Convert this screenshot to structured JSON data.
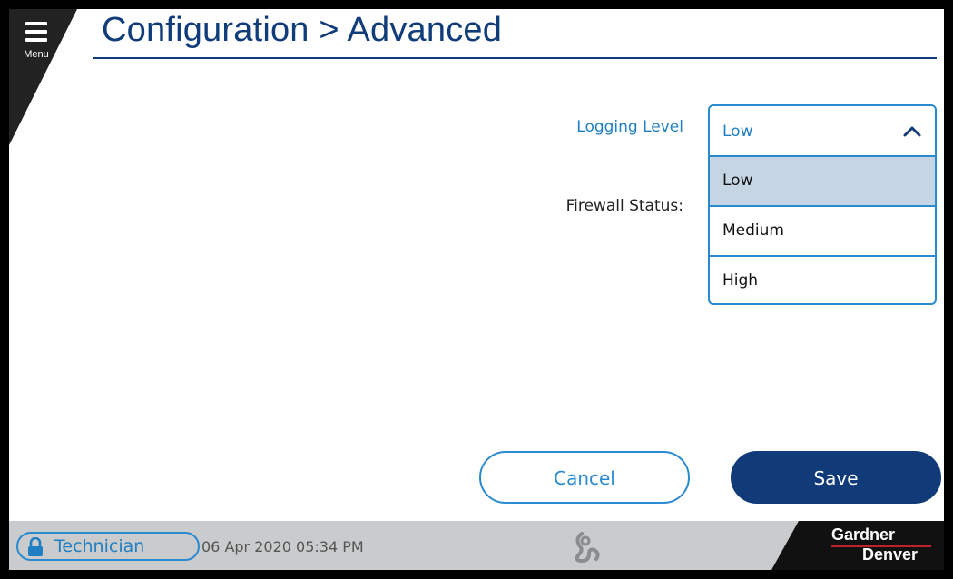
{
  "header": {
    "menu_label": "Menu",
    "title": "Configuration > Advanced"
  },
  "form": {
    "logging_label": "Logging Level",
    "firewall_label": "Firewall Status:",
    "logging_dropdown": {
      "selected": "Low",
      "expanded": true,
      "options": [
        "Low",
        "Medium",
        "High"
      ]
    }
  },
  "actions": {
    "cancel_label": "Cancel",
    "save_label": "Save"
  },
  "status_bar": {
    "user_role": "Technician",
    "datetime": "06 Apr 2020  05:34 PM",
    "brand_line1": "Gardner",
    "brand_line2": "Denver"
  },
  "icons": {
    "menu": "hamburger-icon",
    "dropdown_toggle": "chevron-up-icon",
    "user": "lock-icon",
    "center": "spiral-icon"
  },
  "colors": {
    "title": "#103c7a",
    "accent": "#2a8ad0",
    "primary_button": "#113a79",
    "selected_option": "#c5d5e4",
    "status_bar": "#c9cbcc"
  }
}
